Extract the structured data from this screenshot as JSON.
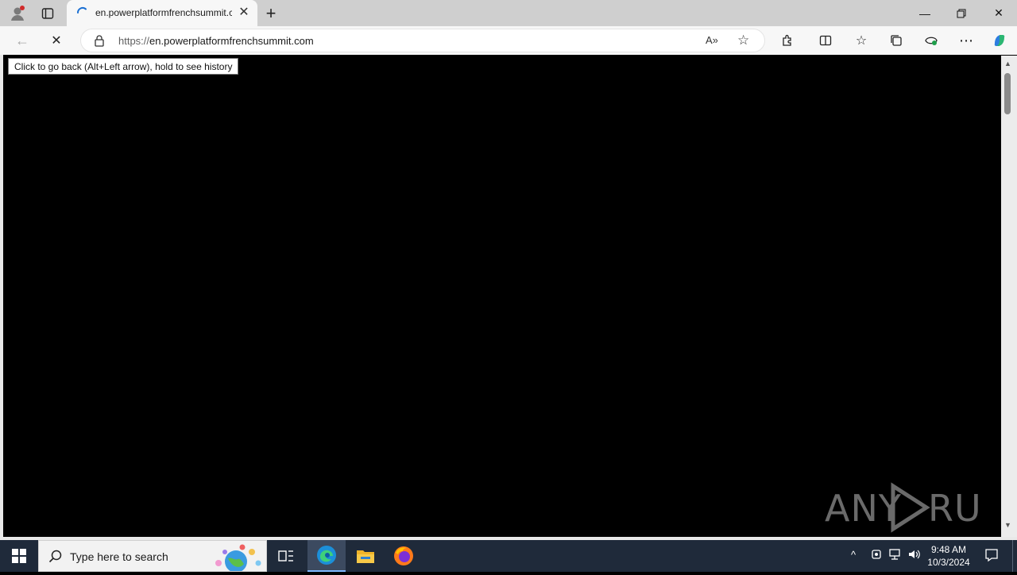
{
  "browser": {
    "tab": {
      "title": "en.powerplatformfrenchsummit.com"
    },
    "new_tab_label": "+",
    "address": {
      "scheme": "https://",
      "host": "en.powerplatformfrenchsummit.com"
    },
    "tooltip": "Click to go back (Alt+Left arrow), hold to see history"
  },
  "watermark": "ANY RUN",
  "taskbar": {
    "search_placeholder": "Type here to search",
    "time": "9:48 AM",
    "date": "10/3/2024"
  },
  "colors": {
    "page_background": "#000000",
    "taskbar": "#1f2a3a",
    "copilot_accent": "#2d7de0"
  }
}
